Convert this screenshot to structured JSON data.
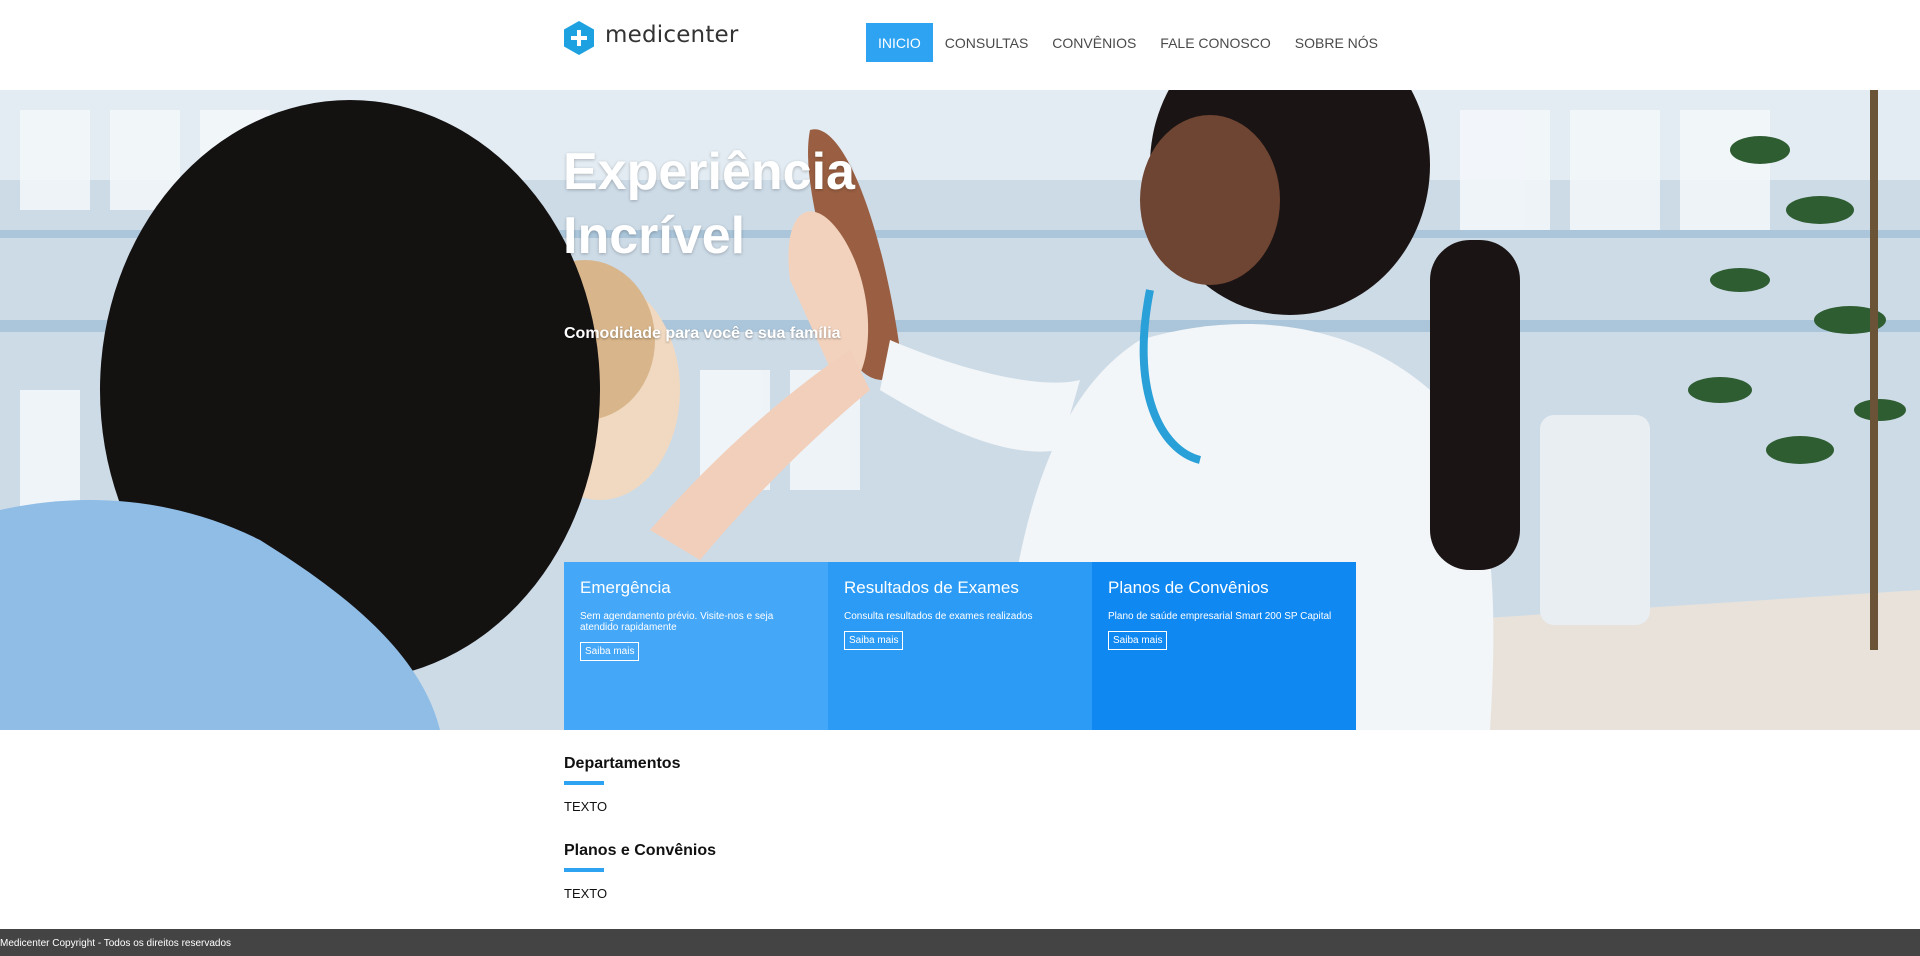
{
  "brand": {
    "name": "medicenter",
    "color": "#2ea3f2"
  },
  "nav": {
    "items": [
      {
        "label": "INICIO",
        "active": true
      },
      {
        "label": "CONSULTAS",
        "active": false
      },
      {
        "label": "CONVÊNIOS",
        "active": false
      },
      {
        "label": "FALE CONOSCO",
        "active": false
      },
      {
        "label": "SOBRE NÓS",
        "active": false
      }
    ]
  },
  "hero": {
    "title_line1": "Experiência",
    "title_line2": "Incrível",
    "subtitle": "Comodidade para você e sua família"
  },
  "cards": [
    {
      "title": "Emergência",
      "text": "Sem agendamento prévio. Visite-nos e seja atendido rapidamente",
      "button": "Saiba mais",
      "color": "#45a7f8"
    },
    {
      "title": "Resultados de Exames",
      "text": "Consulta resultados de exames realizados",
      "button": "Saiba mais",
      "color": "#2b9bf5"
    },
    {
      "title": "Planos de Convênios",
      "text": "Plano de saúde empresarial Smart 200 SP Capital",
      "button": "Saiba mais",
      "color": "#0f88f1"
    }
  ],
  "sections": [
    {
      "title": "Departamentos",
      "text": "TEXTO"
    },
    {
      "title": "Planos e Convênios",
      "text": "TEXTO"
    }
  ],
  "footer": {
    "text": "Medicenter Copyright - Todos os direitos reservados"
  }
}
